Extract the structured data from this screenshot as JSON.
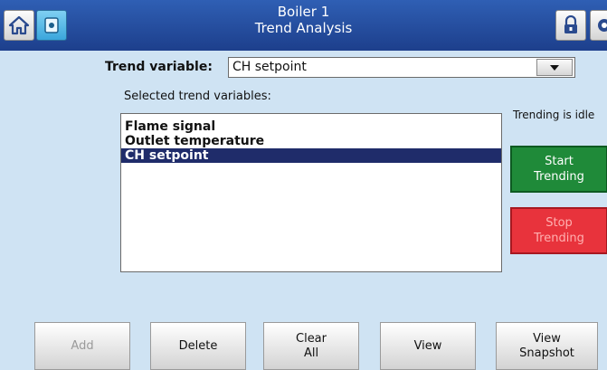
{
  "header": {
    "title_line1": "Boiler 1",
    "title_line2": "Trend Analysis",
    "home_icon": "home-icon",
    "device_icon": "device-icon",
    "lock_icon": "lock-icon",
    "exit_icon": "exit-icon"
  },
  "trend": {
    "variable_label": "Trend variable:",
    "variable_value": "CH setpoint",
    "selected_label": "Selected trend variables:",
    "selected_items": [
      "Flame signal",
      "Outlet temperature",
      "CH setpoint"
    ],
    "selected_index": 2
  },
  "status": {
    "text": "Trending is idle"
  },
  "side_buttons": {
    "start": {
      "line1": "Start",
      "line2": "Trending"
    },
    "stop": {
      "line1": "Stop",
      "line2": "Trending"
    }
  },
  "bottom_buttons": {
    "add": "Add",
    "delete": "Delete",
    "clear_line1": "Clear",
    "clear_line2": "All",
    "view": "View",
    "snapshot_line1": "View",
    "snapshot_line2": "Snapshot"
  },
  "colors": {
    "background": "#cfe3f3",
    "titlebar": "#2a5aad",
    "selected_row": "#1f2c6a",
    "start_green": "#1f8a39",
    "stop_red": "#e8333c"
  }
}
